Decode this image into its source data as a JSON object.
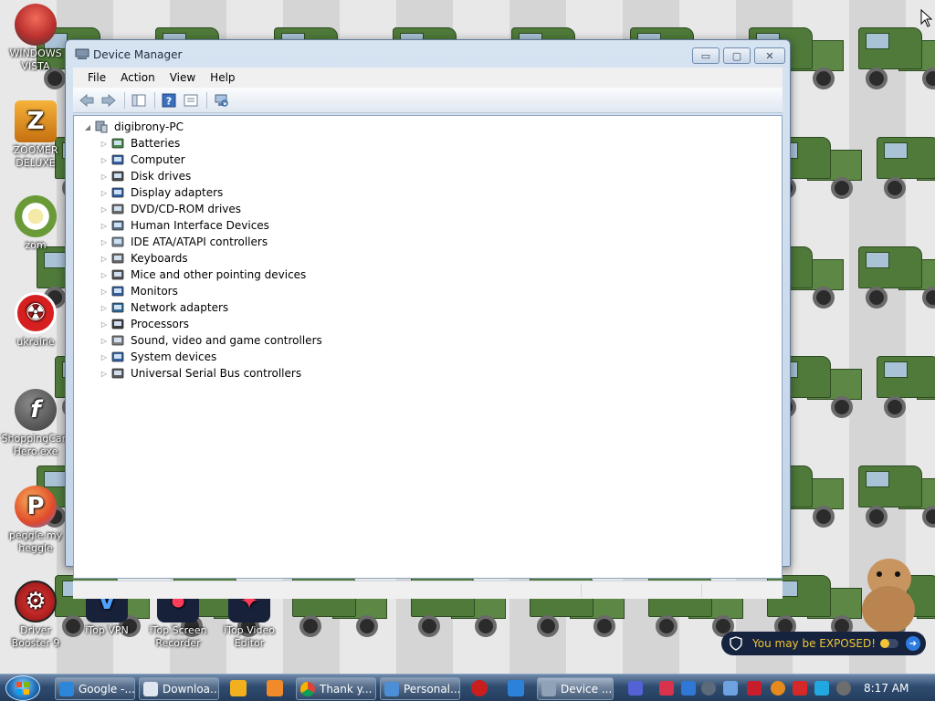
{
  "desktop": {
    "icons": [
      {
        "label": "WINDOWS VISTA",
        "icon": "vista-cauldron-icon",
        "color": "#b9302e"
      },
      {
        "label": "ZOOMER DELUXE",
        "icon": "zoomer-z-icon",
        "color": "#e38a12"
      },
      {
        "label": "zom",
        "icon": "flower-icon",
        "color": "#6a9a38"
      },
      {
        "label": "ukraine",
        "icon": "radiation-icon",
        "color": "#d62020"
      },
      {
        "label": "ShoppingCart Hero.exe",
        "icon": "flash-icon",
        "color": "#4a4a4a"
      },
      {
        "label": "peggle.my heggle",
        "icon": "peggle-p-icon",
        "color": "#e04a2a"
      },
      {
        "label": "Driver Booster 9",
        "icon": "driver-booster-icon",
        "color": "#c91e1e"
      },
      {
        "label": "iTop VPN",
        "icon": "itop-vpn-icon",
        "color": "#1f4aa8"
      },
      {
        "label": "iTop Screen Recorder",
        "icon": "itop-screen-recorder-icon",
        "color": "#c61b33"
      },
      {
        "label": "iTop Video Editor",
        "icon": "itop-video-editor-icon",
        "color": "#c41630"
      }
    ]
  },
  "window": {
    "title": "Device Manager",
    "controls": {
      "minimize": "▭",
      "maximize": "▢",
      "close": "✕"
    },
    "menu": [
      "File",
      "Action",
      "View",
      "Help"
    ],
    "toolbar": [
      "back-arrow-icon",
      "forward-arrow-icon",
      "show-hide-console-tree-icon",
      "help-icon",
      "properties-icon",
      "scan-hardware-icon"
    ],
    "tree": {
      "root": "digibrony-PC",
      "categories": [
        {
          "label": "Batteries",
          "icon": "battery-icon"
        },
        {
          "label": "Computer",
          "icon": "computer-icon"
        },
        {
          "label": "Disk drives",
          "icon": "disk-drive-icon"
        },
        {
          "label": "Display adapters",
          "icon": "display-adapter-icon"
        },
        {
          "label": "DVD/CD-ROM drives",
          "icon": "dvd-drive-icon"
        },
        {
          "label": "Human Interface Devices",
          "icon": "hid-icon"
        },
        {
          "label": "IDE ATA/ATAPI controllers",
          "icon": "ide-controller-icon"
        },
        {
          "label": "Keyboards",
          "icon": "keyboard-icon"
        },
        {
          "label": "Mice and other pointing devices",
          "icon": "mouse-icon"
        },
        {
          "label": "Monitors",
          "icon": "monitor-icon"
        },
        {
          "label": "Network adapters",
          "icon": "network-adapter-icon"
        },
        {
          "label": "Processors",
          "icon": "processor-icon"
        },
        {
          "label": "Sound, video and game controllers",
          "icon": "speaker-icon"
        },
        {
          "label": "System devices",
          "icon": "system-device-icon"
        },
        {
          "label": "Universal Serial Bus controllers",
          "icon": "usb-icon"
        }
      ]
    }
  },
  "notification": {
    "text": "You may be EXPOSED!",
    "color": "#f2c535"
  },
  "taskbar": {
    "buttons": [
      {
        "label": "Google -...",
        "icon": "ie-icon"
      },
      {
        "label": "Downloa...",
        "icon": "download-icon"
      },
      {
        "label": "Thank y...",
        "icon": "chrome-icon"
      },
      {
        "label": "Personal...",
        "icon": "personalize-icon"
      },
      {
        "label": "Device ...",
        "icon": "device-manager-icon",
        "active": true
      }
    ],
    "clock": "8:17 AM"
  }
}
